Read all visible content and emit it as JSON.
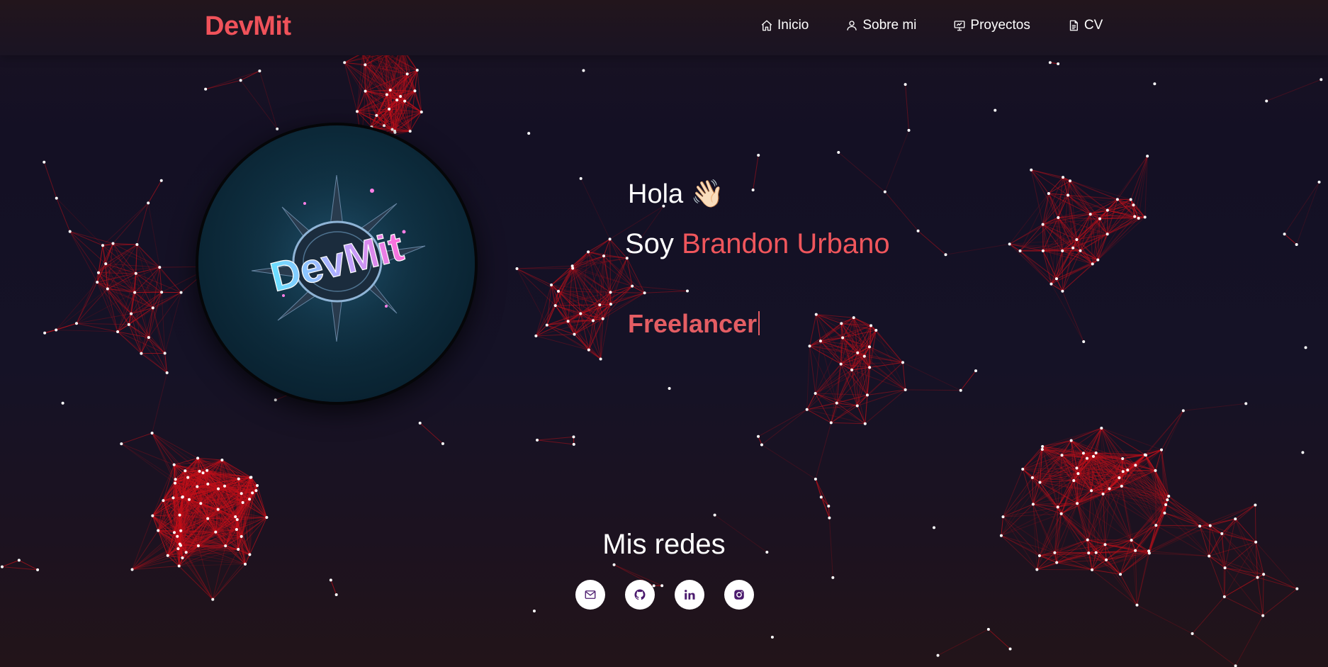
{
  "brand": "DevMit",
  "nav": [
    {
      "label": "Inicio",
      "icon": "home-icon"
    },
    {
      "label": "Sobre mi",
      "icon": "user-icon"
    },
    {
      "label": "Proyectos",
      "icon": "presentation-icon"
    },
    {
      "label": "CV",
      "icon": "document-icon"
    }
  ],
  "hero": {
    "greeting": "Hola",
    "wave_emoji": "👋🏻",
    "intro_prefix": "Soy",
    "name": "Brandon Urbano",
    "role": "Freelancer",
    "avatar_logo_text": "DevMit"
  },
  "socials": {
    "title": "Mis redes",
    "links": [
      {
        "name": "email",
        "icon": "mail-icon"
      },
      {
        "name": "github",
        "icon": "github-icon"
      },
      {
        "name": "linkedin",
        "icon": "linkedin-icon"
      },
      {
        "name": "instagram",
        "icon": "instagram-icon"
      }
    ]
  },
  "colors": {
    "accent": "#f0525a",
    "particles": "#c4101a",
    "background": "#151226",
    "social_icon": "#4b1a6e"
  }
}
